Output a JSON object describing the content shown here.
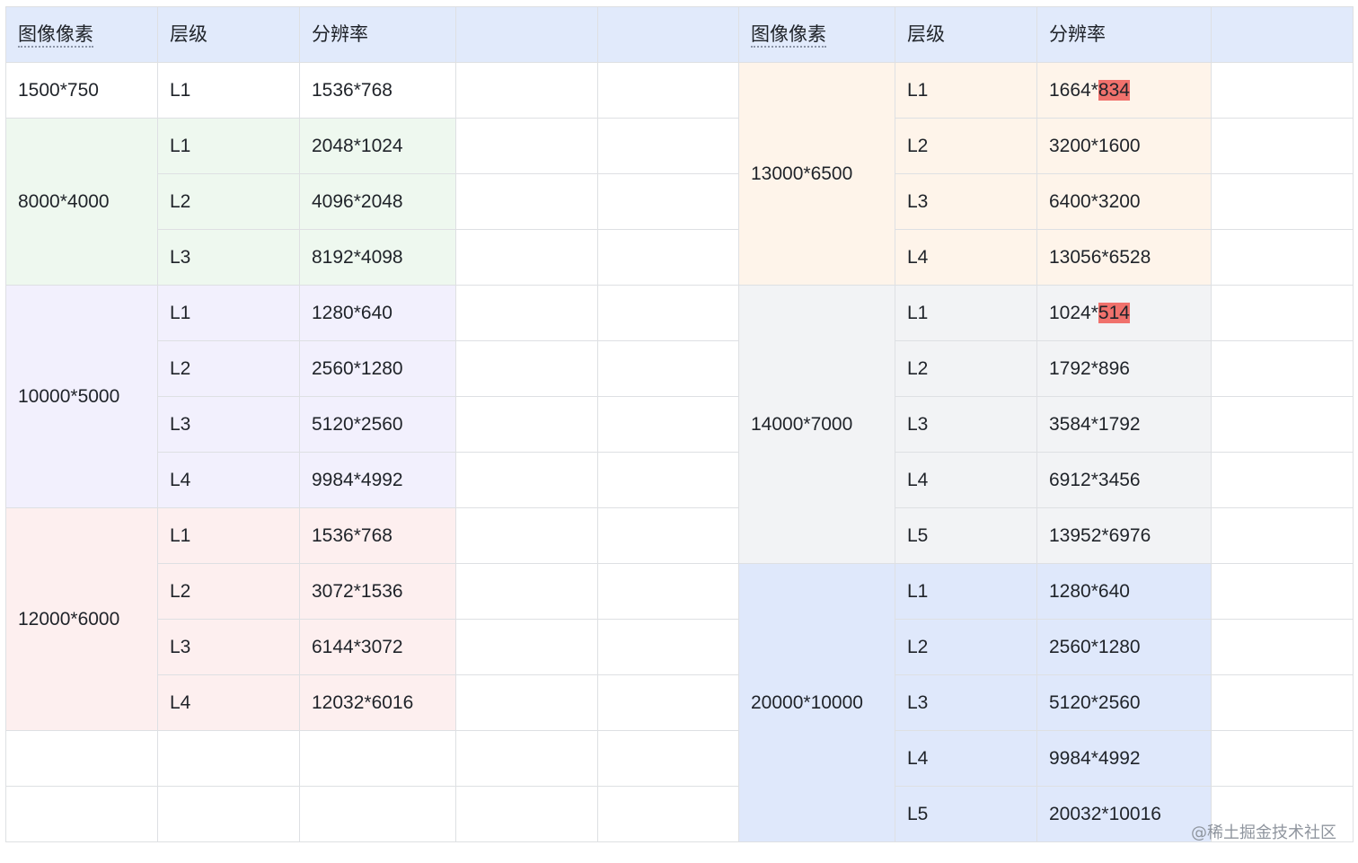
{
  "colors": {
    "header": "#e1eafb",
    "green": "#eef8ef",
    "purple": "#f2f0fd",
    "pink": "#fdefef",
    "orange": "#fef4ea",
    "gray": "#f2f3f5",
    "blue": "#dfe8fb",
    "highlight": "#f0716c"
  },
  "header": {
    "left": [
      "图像像素",
      "层级",
      "分辨率",
      "",
      ""
    ],
    "right": [
      "图像像素",
      "层级",
      "分辨率",
      ""
    ]
  },
  "left_groups": [
    {
      "pixels": "1500*750",
      "color": "none",
      "rows": [
        {
          "level": "L1",
          "res": "1536*768"
        }
      ]
    },
    {
      "pixels": "8000*4000",
      "color": "green",
      "rows": [
        {
          "level": "L1",
          "res": "2048*1024"
        },
        {
          "level": "L2",
          "res": "4096*2048"
        },
        {
          "level": "L3",
          "res": "8192*4098"
        }
      ]
    },
    {
      "pixels": "10000*5000",
      "color": "purple",
      "rows": [
        {
          "level": "L1",
          "res": "1280*640"
        },
        {
          "level": "L2",
          "res": "2560*1280"
        },
        {
          "level": "L3",
          "res": "5120*2560"
        },
        {
          "level": "L4",
          "res": "9984*4992"
        }
      ]
    },
    {
      "pixels": "12000*6000",
      "color": "pink",
      "rows": [
        {
          "level": "L1",
          "res": "1536*768"
        },
        {
          "level": "L2",
          "res": "3072*1536"
        },
        {
          "level": "L3",
          "res": "6144*3072"
        },
        {
          "level": "L4",
          "res": "12032*6016"
        }
      ]
    },
    {
      "pixels": "",
      "color": "none",
      "rows": [
        {
          "level": "",
          "res": ""
        }
      ]
    },
    {
      "pixels": "",
      "color": "none",
      "rows": [
        {
          "level": "",
          "res": ""
        }
      ]
    }
  ],
  "right_groups": [
    {
      "pixels": "13000*6500",
      "color": "orange",
      "rows": [
        {
          "level": "L1",
          "res": "1664*",
          "res_hl": "834"
        },
        {
          "level": "L2",
          "res": "3200*1600"
        },
        {
          "level": "L3",
          "res": "6400*3200"
        },
        {
          "level": "L4",
          "res": "13056*6528"
        }
      ]
    },
    {
      "pixels": "14000*7000",
      "color": "gray",
      "rows": [
        {
          "level": "L1",
          "res": "1024*",
          "res_hl": "514"
        },
        {
          "level": "L2",
          "res": "1792*896"
        },
        {
          "level": "L3",
          "res": "3584*1792"
        },
        {
          "level": "L4",
          "res": "6912*3456"
        },
        {
          "level": "L5",
          "res": "13952*6976"
        }
      ]
    },
    {
      "pixels": "20000*10000",
      "color": "blue",
      "rows": [
        {
          "level": "L1",
          "res": "1280*640"
        },
        {
          "level": "L2",
          "res": "2560*1280"
        },
        {
          "level": "L3",
          "res": "5120*2560"
        },
        {
          "level": "L4",
          "res": "9984*4992"
        },
        {
          "level": "L5",
          "res": "20032*10016"
        }
      ]
    }
  ],
  "watermark": "@稀土掘金技术社区"
}
